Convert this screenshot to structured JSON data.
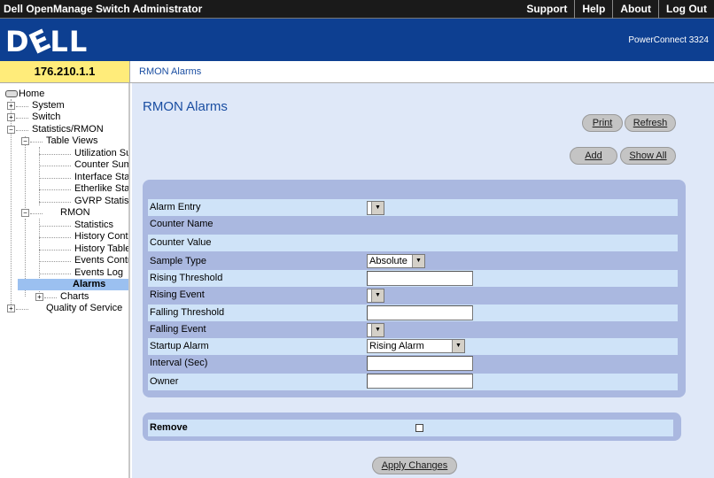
{
  "app": {
    "title": "Dell OpenManage Switch Administrator",
    "model": "PowerConnect 3324",
    "logo": "DELL"
  },
  "top_nav": [
    "Support",
    "Help",
    "About",
    "Log Out"
  ],
  "device_ip": "176.210.1.1",
  "breadcrumb": "RMON Alarms",
  "tree": {
    "home": "Home",
    "system": "System",
    "switch": "Switch",
    "stats": "Statistics/RMON",
    "table_views": "Table Views",
    "util": "Utilization Su",
    "counter": "Counter Sum",
    "interface": "Interface Stat",
    "etherlike": "Etherlike Sta",
    "gvrp": "GVRP Statis",
    "rmon": "RMON",
    "statistics": "Statistics",
    "hist_ctrl": "History Contr",
    "hist_table": "History Table",
    "events_ctrl": "Events Contr",
    "events_log": "Events Log",
    "alarms": "Alarms",
    "charts": "Charts",
    "qos": "Quality of Service"
  },
  "page": {
    "title": "RMON Alarms",
    "buttons": {
      "print": "Print",
      "refresh": "Refresh",
      "add": "Add",
      "show_all": "Show All",
      "apply": "Apply Changes"
    }
  },
  "form": {
    "alarm_entry": "Alarm Entry",
    "counter_name": "Counter Name",
    "counter_value": "Counter Value",
    "sample_type": "Sample Type",
    "sample_type_value": "Absolute",
    "rising_threshold": "Rising Threshold",
    "rising_event": "Rising Event",
    "falling_threshold": "Falling Threshold",
    "falling_event": "Falling Event",
    "startup_alarm": "Startup Alarm",
    "startup_alarm_value": "Rising Alarm",
    "interval": "Interval (Sec)",
    "owner": "Owner",
    "remove": "Remove"
  }
}
